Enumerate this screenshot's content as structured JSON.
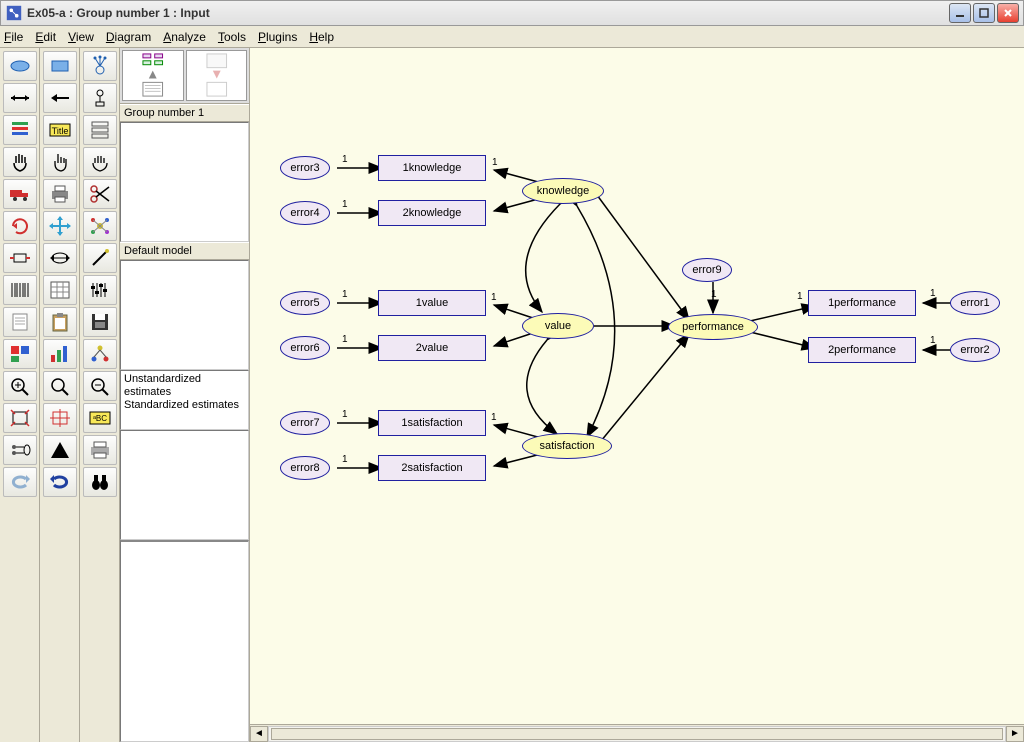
{
  "window": {
    "title": "Ex05-a : Group number 1 : Input"
  },
  "menu": {
    "file": "File",
    "edit": "Edit",
    "view": "View",
    "diagram": "Diagram",
    "analyze": "Analyze",
    "tools": "Tools",
    "plugins": "Plugins",
    "help": "Help"
  },
  "sidepanels": {
    "group_label": "Group number 1",
    "model_label": "Default model",
    "est_unstd": "Unstandardized estimates",
    "est_std": "Standardized estimates"
  },
  "diagram": {
    "errors": {
      "e3": "error3",
      "e4": "error4",
      "e5": "error5",
      "e6": "error6",
      "e7": "error7",
      "e8": "error8",
      "e9": "error9",
      "e1": "error1",
      "e2": "error2"
    },
    "observed": {
      "k1": "1knowledge",
      "k2": "2knowledge",
      "v1": "1value",
      "v2": "2value",
      "s1": "1satisfaction",
      "s2": "2satisfaction",
      "p1": "1performance",
      "p2": "2performance"
    },
    "latent": {
      "knowledge": "knowledge",
      "value": "value",
      "satisfaction": "satisfaction",
      "performance": "performance"
    },
    "one": "1"
  }
}
